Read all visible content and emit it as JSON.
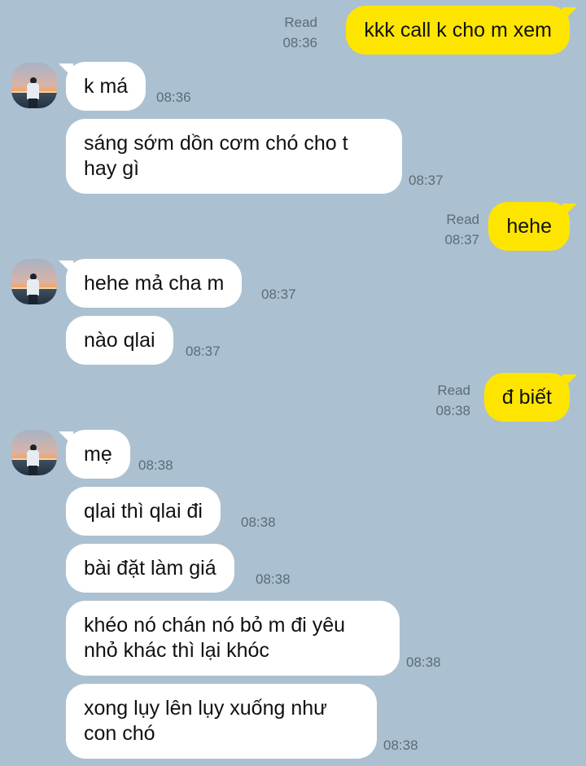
{
  "messages": [
    {
      "side": "out",
      "read": "Read",
      "time": "08:36",
      "text": "kkk call k cho m xem"
    },
    {
      "side": "in",
      "time": "08:36",
      "text": "k má"
    },
    {
      "side": "in",
      "time": "08:37",
      "text": "sáng sớm dồn cơm chó cho t hay gì"
    },
    {
      "side": "out",
      "read": "Read",
      "time": "08:37",
      "text": "hehe"
    },
    {
      "side": "in",
      "time": "08:37",
      "text": "hehe mả cha m"
    },
    {
      "side": "in",
      "time": "08:37",
      "text": "nào qlai"
    },
    {
      "side": "out",
      "read": "Read",
      "time": "08:38",
      "text": "đ biết"
    },
    {
      "side": "in",
      "time": "08:38",
      "text": "mẹ"
    },
    {
      "side": "in",
      "time": "08:38",
      "text": "qlai thì qlai đi"
    },
    {
      "side": "in",
      "time": "08:38",
      "text": "bài đặt làm giá"
    },
    {
      "side": "in",
      "time": "08:38",
      "text": "khéo nó chán nó bỏ m đi yêu nhỏ khác thì lại khóc"
    },
    {
      "side": "in",
      "time": "08:38",
      "text": "xong lụy lên lụy xuống như con chó"
    }
  ]
}
